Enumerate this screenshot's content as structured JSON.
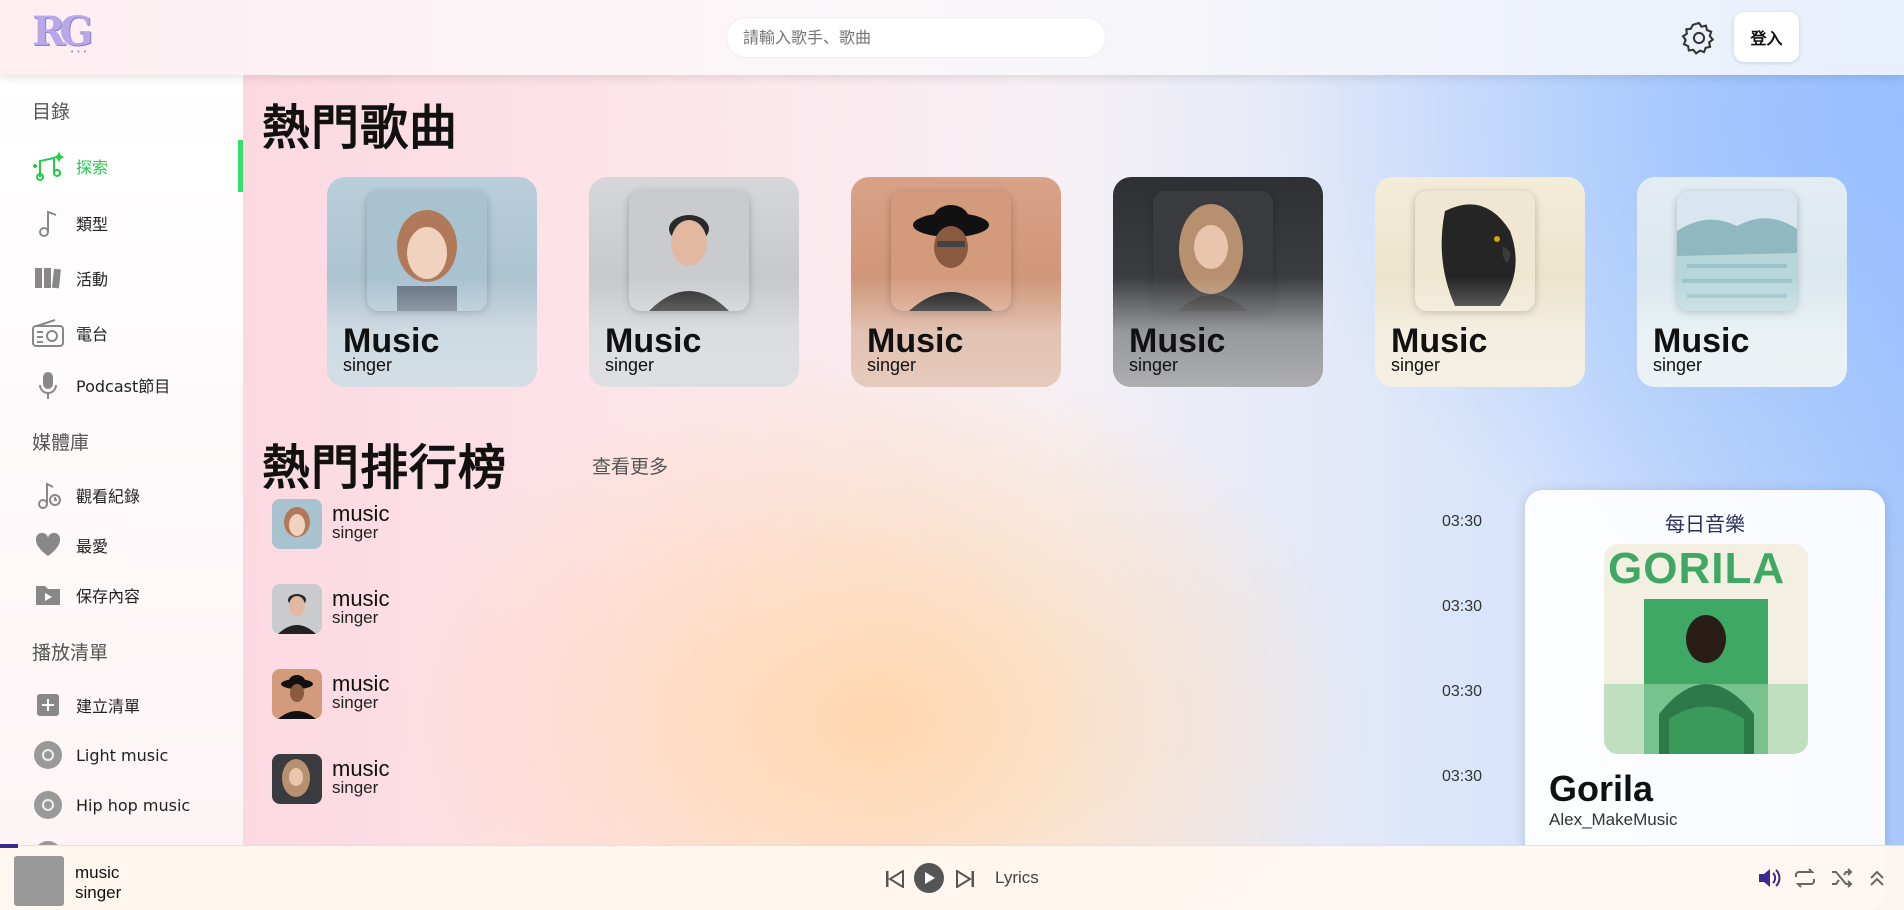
{
  "header": {
    "logo": "RG",
    "logo_sub": "• • •",
    "search_placeholder": "請輸入歌手、歌曲",
    "login_label": "登入"
  },
  "sidebar": {
    "catalog_heading": "目錄",
    "catalog_items": [
      {
        "label": "探索",
        "icon": "music-notes-icon",
        "active": true
      },
      {
        "label": "類型",
        "icon": "music-note-icon"
      },
      {
        "label": "活動",
        "icon": "library-bars-icon"
      },
      {
        "label": "電台",
        "icon": "radio-icon"
      },
      {
        "label": "Podcast節目",
        "icon": "microphone-icon"
      }
    ],
    "library_heading": "媒體庫",
    "library_items": [
      {
        "label": "觀看紀錄",
        "icon": "history-note-icon"
      },
      {
        "label": "最愛",
        "icon": "heart-icon"
      },
      {
        "label": "保存內容",
        "icon": "folder-icon"
      }
    ],
    "playlist_heading": "播放清單",
    "playlist_items": [
      {
        "label": "建立清單",
        "icon": "add-square-icon"
      },
      {
        "label": "Light music",
        "icon": "disc-icon"
      },
      {
        "label": "Hip hop music",
        "icon": "disc-icon"
      }
    ]
  },
  "hot_songs": {
    "title": "熱門歌曲",
    "cards": [
      {
        "title": "Music",
        "subtitle": "singer",
        "color_bg": "#a9c2d0",
        "color_fg": "#b07a5a"
      },
      {
        "title": "Music",
        "subtitle": "singer",
        "color_bg": "#c9cbcf",
        "color_fg": "#2a2a2a"
      },
      {
        "title": "Music",
        "subtitle": "singer",
        "color_bg": "#d49a7c",
        "color_fg": "#1a1a1a"
      },
      {
        "title": "Music",
        "subtitle": "singer",
        "color_bg": "#3a3b3e",
        "color_fg": "#b79070"
      },
      {
        "title": "Music",
        "subtitle": "singer",
        "color_bg": "#efe7d2",
        "color_fg": "#252525"
      },
      {
        "title": "Music",
        "subtitle": "singer",
        "color_bg": "#d8e6ef",
        "color_fg": "#8fb8c0"
      }
    ]
  },
  "charts": {
    "title": "熱門排行榜",
    "see_more": "查看更多",
    "rows": [
      {
        "title": "music",
        "singer": "singer",
        "duration": "03:30",
        "thumb_bg": "#a9c2d0",
        "thumb_fg": "#b07a5a"
      },
      {
        "title": "music",
        "singer": "singer",
        "duration": "03:30",
        "thumb_bg": "#c9cbcf",
        "thumb_fg": "#2a2a2a"
      },
      {
        "title": "music",
        "singer": "singer",
        "duration": "03:30",
        "thumb_bg": "#d49a7c",
        "thumb_fg": "#1a1a1a"
      },
      {
        "title": "music",
        "singer": "singer",
        "duration": "03:30",
        "thumb_bg": "#3a3b3e",
        "thumb_fg": "#b79070"
      }
    ]
  },
  "daily": {
    "heading": "每日音樂",
    "cover_text": "GORILA",
    "song": "Gorila",
    "artist": "Alex_MakeMusic"
  },
  "player": {
    "title": "music",
    "singer": "singer",
    "lyrics_label": "Lyrics",
    "accent": "#3b2b8a"
  }
}
